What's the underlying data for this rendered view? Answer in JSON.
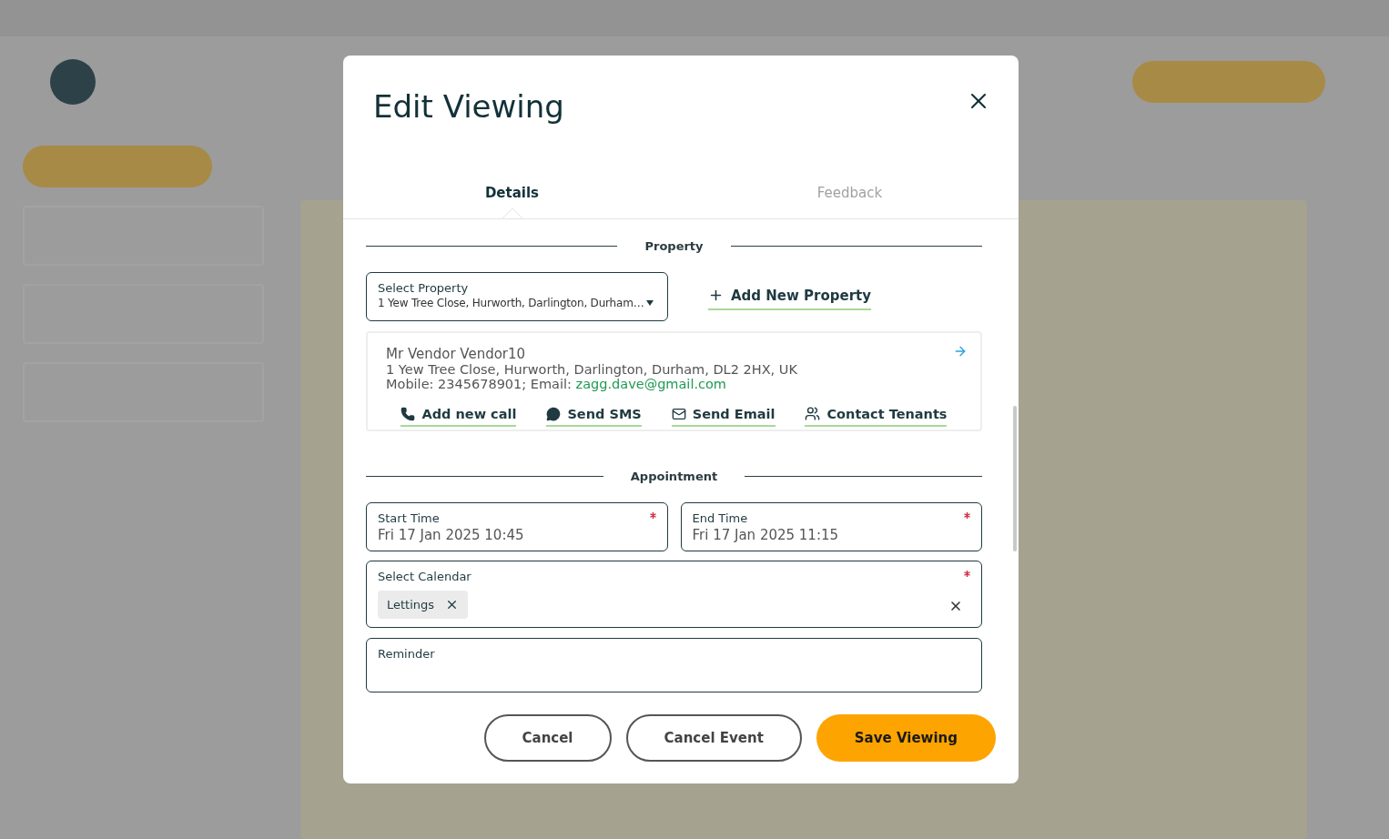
{
  "dialog": {
    "title": "Edit Viewing",
    "tabs": [
      {
        "label": "Details",
        "selected": true
      },
      {
        "label": "Feedback",
        "selected": false
      }
    ],
    "property_section": {
      "heading": "Property",
      "select": {
        "label": "Select Property",
        "value": "1 Yew Tree Close, Hurworth, Darlington, Durham…"
      },
      "add_button": "Add New Property",
      "contact": {
        "name": "Mr Vendor Vendor10",
        "address": "1 Yew Tree Close, Hurworth, Darlington, Durham, DL2 2HX, UK",
        "details": "Mobile: 2345678901; Email: ",
        "email": "zagg.dave@gmail.com",
        "actions": [
          {
            "kind": "call",
            "label": "Add new call"
          },
          {
            "kind": "sms",
            "label": "Send SMS"
          },
          {
            "kind": "email",
            "label": "Send Email"
          },
          {
            "kind": "tenants",
            "label": "Contact Tenants"
          }
        ]
      }
    },
    "appointment_section": {
      "heading": "Appointment",
      "start": {
        "label": "Start Time",
        "value": "Fri 17 Jan 2025 10:45",
        "required": true
      },
      "end": {
        "label": "End Time",
        "value": "Fri 17 Jan 2025 11:15",
        "required": true
      },
      "calendar": {
        "label": "Select Calendar",
        "required": true,
        "chips": [
          "Lettings"
        ]
      },
      "reminder": {
        "label": "Reminder"
      }
    },
    "buttons": [
      {
        "kind": "outline",
        "label": "Cancel"
      },
      {
        "kind": "outline",
        "label": "Cancel Event"
      },
      {
        "kind": "primary",
        "label": "Save Viewing"
      }
    ]
  }
}
